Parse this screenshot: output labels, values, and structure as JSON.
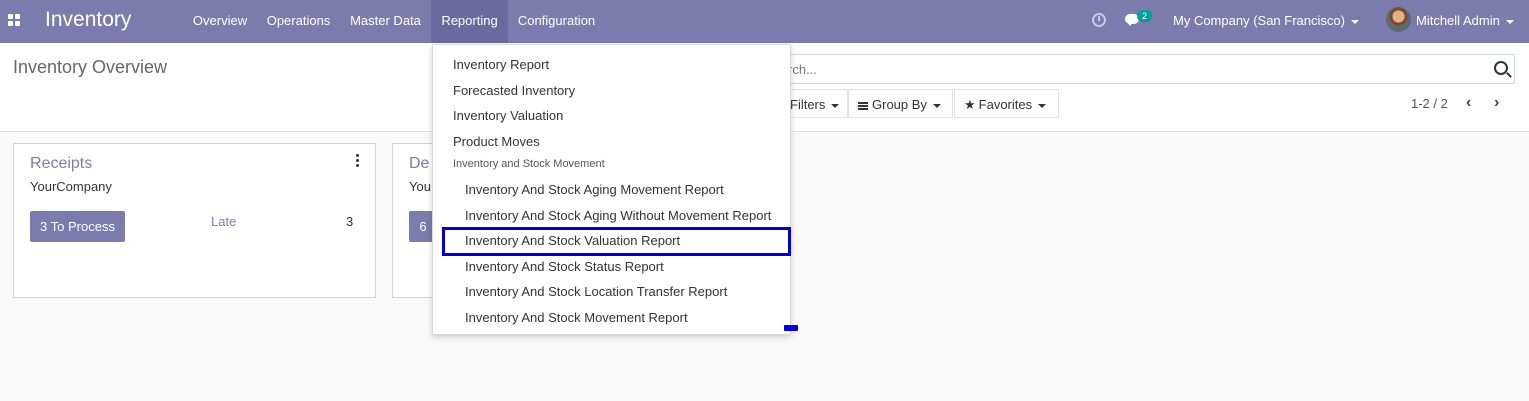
{
  "navbar": {
    "brand": "Inventory",
    "menu": [
      "Overview",
      "Operations",
      "Master Data",
      "Reporting",
      "Configuration"
    ],
    "active_menu": "Reporting",
    "chat_count": "2",
    "company": "My Company (San Francisco)",
    "user": "Mitchell Admin",
    "icons": [
      "apps-icon",
      "clock-icon",
      "chat-icon",
      "avatar"
    ]
  },
  "control_panel": {
    "title": "Inventory Overview",
    "search_placeholder": "rch...",
    "filters_label": "Filters",
    "groupby_label": "Group By",
    "favorites_label": "Favorites",
    "pager": "1-2 / 2"
  },
  "cards": [
    {
      "title": "Receipts",
      "company": "YourCompany",
      "button": "3 To Process",
      "late_label": "Late",
      "late_count": "3"
    },
    {
      "title": "De",
      "company": "You",
      "button": "6"
    }
  ],
  "reporting_menu": {
    "items": [
      "Inventory Report",
      "Forecasted Inventory",
      "Inventory Valuation",
      "Product Moves"
    ],
    "section_header": "Inventory and Stock Movement",
    "sub_items": [
      "Inventory And Stock Aging Movement Report",
      "Inventory And Stock Aging Without Movement Report",
      "Inventory And Stock Valuation Report",
      "Inventory And Stock Status Report",
      "Inventory And Stock Location Transfer Report",
      "Inventory And Stock Movement Report"
    ],
    "highlighted": "Inventory And Stock Valuation Report"
  },
  "colors": {
    "brand": "#7c7bad",
    "highlight_border": "#0000cc",
    "badge": "#00a09d"
  }
}
